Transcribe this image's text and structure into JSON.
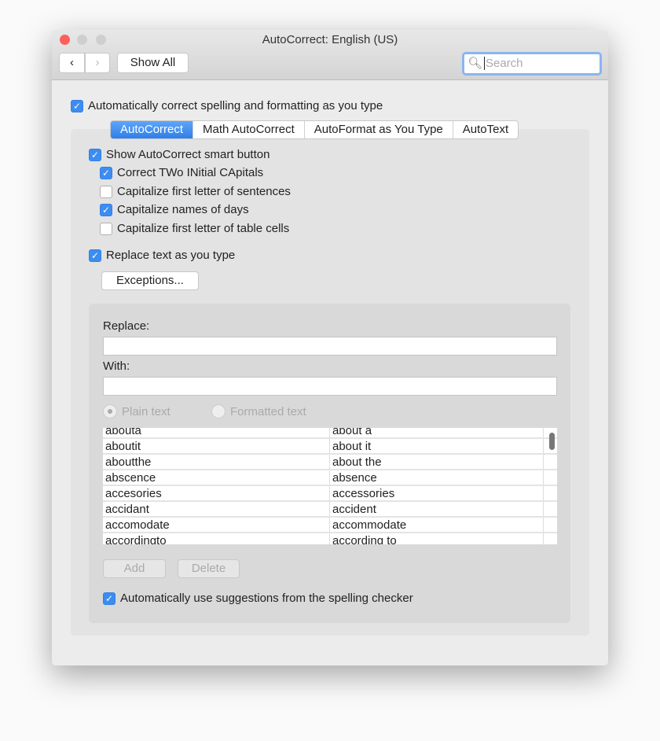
{
  "window": {
    "title": "AutoCorrect: English (US)"
  },
  "toolbar": {
    "show_all": "Show All",
    "search_placeholder": "Search"
  },
  "main": {
    "auto_correct_label": "Automatically correct spelling and formatting as you type",
    "auto_correct_checked": true
  },
  "tabs": [
    {
      "label": "AutoCorrect",
      "active": true
    },
    {
      "label": "Math AutoCorrect"
    },
    {
      "label": "AutoFormat as You Type"
    },
    {
      "label": "AutoText"
    }
  ],
  "options": [
    {
      "label": "Show AutoCorrect smart button",
      "checked": true
    },
    {
      "label": "Correct TWo INitial CApitals",
      "checked": true
    },
    {
      "label": "Capitalize first letter of sentences",
      "checked": false
    },
    {
      "label": "Capitalize names of days",
      "checked": true
    },
    {
      "label": "Capitalize first letter of table cells",
      "checked": false
    },
    {
      "label": "Replace text as you type",
      "checked": true
    }
  ],
  "exceptions_label": "Exceptions...",
  "replace_label": "Replace:",
  "with_label": "With:",
  "replace_value": "",
  "with_value": "",
  "radio": {
    "plain": "Plain text",
    "formatted": "Formatted text",
    "selected": "plain"
  },
  "entries": [
    [
      "abouta",
      "about a"
    ],
    [
      "aboutit",
      "about it"
    ],
    [
      "aboutthe",
      "about the"
    ],
    [
      "abscence",
      "absence"
    ],
    [
      "accesories",
      "accessories"
    ],
    [
      "accidant",
      "accident"
    ],
    [
      "accomodate",
      "accommodate"
    ],
    [
      "accordingto",
      "according to"
    ]
  ],
  "add_label": "Add",
  "delete_label": "Delete",
  "suggestions_label": "Automatically use suggestions from the spelling checker",
  "suggestions_checked": true,
  "colors": {
    "accent": "#3d8cf0",
    "close": "#fc605c"
  }
}
